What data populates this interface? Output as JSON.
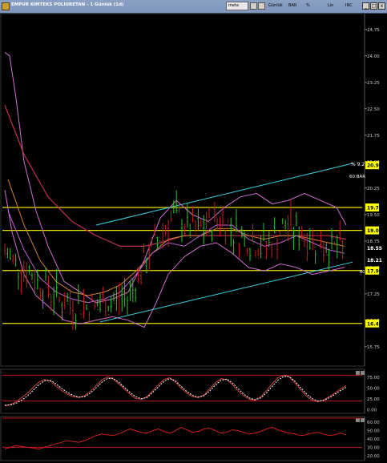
{
  "window": {
    "title": "EMPUR KIMTEKS POLIURETAN - 1 Günlük (1d)",
    "interval_value": "meta",
    "toolbar_items": [
      "Günlük",
      "BAR",
      "%",
      "Lin",
      "INC"
    ],
    "win_buttons": [
      "_",
      "□",
      "x"
    ]
  },
  "price_panel": {
    "price_axis_labels": [
      "24.75",
      "24.00",
      "23.25",
      "22.50",
      "21.75",
      "21.00",
      "20.25",
      "19.50",
      "18.75",
      "18.00",
      "17.25",
      "16.50",
      "15.75"
    ],
    "price_axis_values": [
      24.75,
      24.0,
      23.25,
      22.5,
      21.75,
      21.0,
      20.25,
      19.5,
      18.75,
      18.0,
      17.25,
      16.5,
      15.75
    ],
    "price_scale": {
      "min": 15.2,
      "max": 25.2
    },
    "horizontal_levels": [
      {
        "value": 19.7,
        "label": "19.70"
      },
      {
        "value": 19.05,
        "label": "19.05"
      },
      {
        "value": 17.91,
        "label": "17.91"
      },
      {
        "value": 16.41,
        "label": "16.41"
      }
    ],
    "price_tags": [
      {
        "label": "20.90",
        "value": 20.9,
        "bg": "#ffff00",
        "fg": "#000000"
      },
      {
        "label": "19.70",
        "value": 19.7,
        "bg": "#ffff00",
        "fg": "#000000"
      },
      {
        "label": "19.05",
        "value": 19.05,
        "bg": "#ffff00",
        "fg": "#000000"
      },
      {
        "label": "18.55",
        "value": 18.55,
        "bg": "#000000",
        "fg": "#ffffff"
      },
      {
        "label": "18.21",
        "value": 18.21,
        "bg": "#000000",
        "fg": "#ffffff"
      },
      {
        "label": "17.91",
        "value": 17.91,
        "bg": "#ffff00",
        "fg": "#000000"
      },
      {
        "label": "16.41",
        "value": 16.41,
        "bg": "#ffff00",
        "fg": "#000000"
      }
    ],
    "overlay_texts": [
      "% 9.2",
      "60 BAR",
      "60"
    ]
  },
  "oscillator_panel": {
    "axis_labels": [
      "75.00",
      "50.00",
      "25.00",
      "0.00"
    ],
    "axis_values": [
      75,
      50,
      25,
      0
    ],
    "reference_lines": [
      80,
      20
    ],
    "series_main": [
      8,
      12,
      18,
      28,
      38,
      52,
      64,
      70,
      66,
      55,
      44,
      36,
      30,
      28,
      32,
      42,
      55,
      68,
      76,
      72,
      60,
      48,
      36,
      26,
      24,
      30,
      44,
      58,
      70,
      74,
      64,
      50,
      38,
      30,
      28,
      34,
      48,
      62,
      72,
      70,
      58,
      44,
      32,
      24,
      22,
      30,
      44,
      60,
      74,
      80,
      76,
      62,
      46,
      32,
      22,
      18,
      22,
      30,
      38,
      48,
      56
    ],
    "series_signal": [
      10,
      11,
      15,
      22,
      32,
      45,
      58,
      67,
      68,
      60,
      49,
      40,
      33,
      29,
      30,
      38,
      50,
      63,
      72,
      73,
      64,
      52,
      40,
      30,
      25,
      28,
      40,
      53,
      66,
      72,
      67,
      54,
      42,
      33,
      29,
      32,
      43,
      57,
      68,
      71,
      62,
      49,
      36,
      27,
      23,
      27,
      39,
      54,
      68,
      77,
      77,
      66,
      51,
      37,
      26,
      20,
      21,
      27,
      35,
      44,
      52
    ]
  },
  "rsi_panel": {
    "axis_labels": [
      "60.00",
      "50.00",
      "40.00",
      "30.00",
      "20.00"
    ],
    "axis_values": [
      60,
      50,
      40,
      30,
      20
    ],
    "reference_lines": [
      70,
      30
    ],
    "series": [
      28,
      30,
      32,
      31,
      30,
      29,
      28,
      30,
      32,
      34,
      36,
      38,
      37,
      36,
      38,
      41,
      44,
      46,
      45,
      44,
      46,
      49,
      52,
      50,
      48,
      47,
      50,
      52,
      49,
      47,
      50,
      54,
      51,
      48,
      49,
      52,
      53,
      50,
      47,
      48,
      51,
      50,
      48,
      46,
      47,
      49,
      52,
      54,
      51,
      49,
      47,
      46,
      44,
      45,
      47,
      48,
      46,
      44,
      45,
      47,
      45
    ]
  }
}
